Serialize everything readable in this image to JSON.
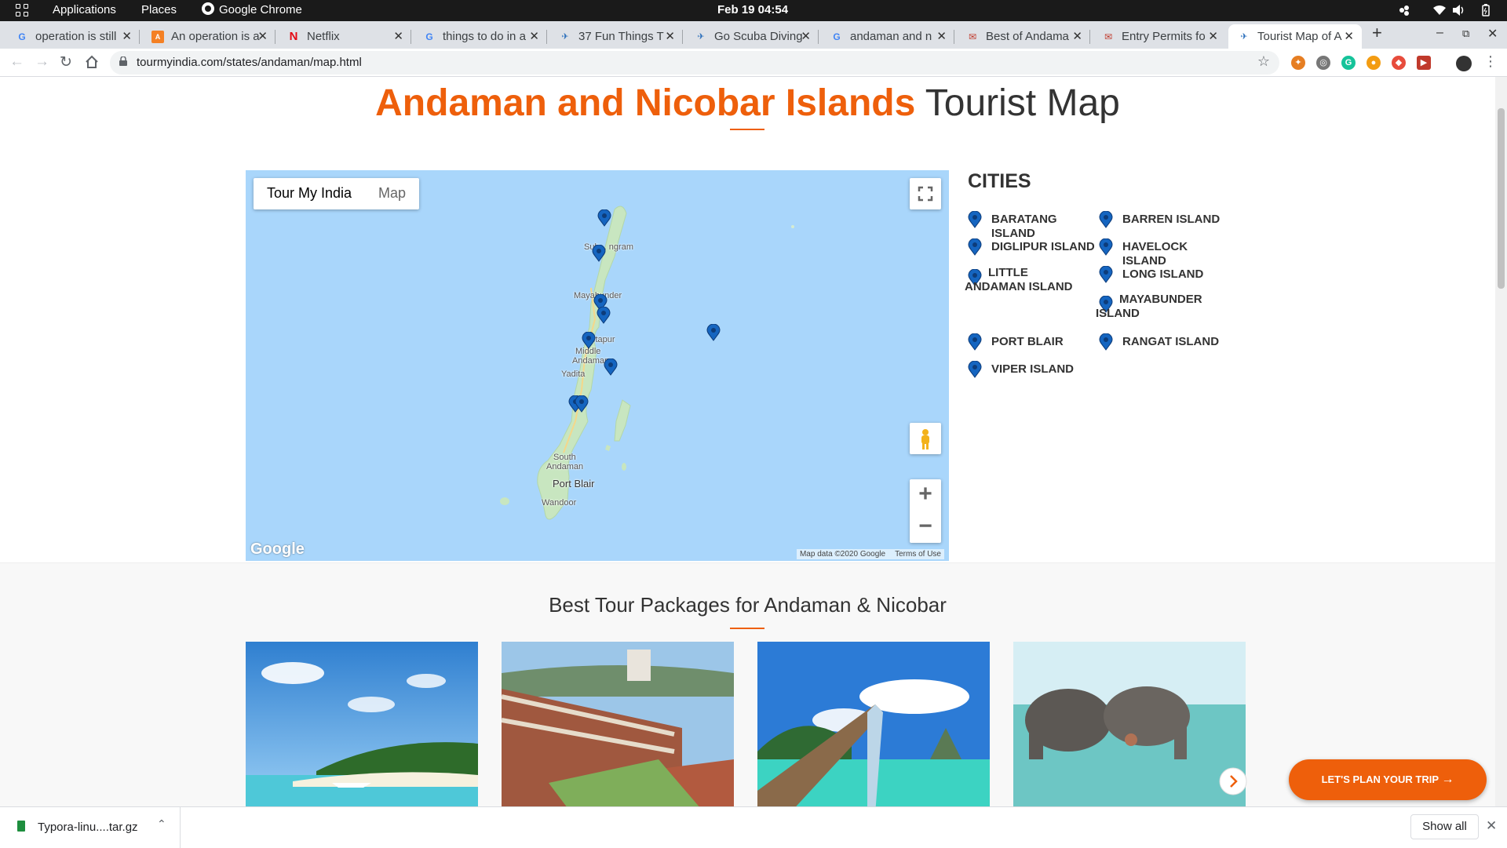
{
  "topbar": {
    "applications": "Applications",
    "places": "Places",
    "active_app": "Google Chrome",
    "clock": "Feb 19  04:54"
  },
  "tabs": [
    {
      "title": "operation is still",
      "icon": "google-icon"
    },
    {
      "title": "An operation is a",
      "icon": "askubuntu-icon"
    },
    {
      "title": "Netflix",
      "icon": "netflix-icon"
    },
    {
      "title": "things to do in a",
      "icon": "google-icon"
    },
    {
      "title": "37 Fun Things T",
      "icon": "site-icon"
    },
    {
      "title": "Go Scuba Diving",
      "icon": "site-icon"
    },
    {
      "title": "andaman and n",
      "icon": "google-icon"
    },
    {
      "title": "Best of Andama",
      "icon": "site-icon"
    },
    {
      "title": "Entry Permits fo",
      "icon": "site-icon"
    },
    {
      "title": "Tourist Map of A",
      "icon": "site-icon"
    }
  ],
  "url": "tourmyindia.com/states/andaman/map.html",
  "page": {
    "title_highlight": "Andaman and Nicobar Islands",
    "title_rest": " Tourist Map"
  },
  "map": {
    "toggle_active": "Tour My India",
    "toggle_inactive": "Map",
    "labels": [
      "Sub... ngram",
      "Mayabunder",
      "Betapur",
      "Middle",
      "Andaman",
      "Yadita",
      "South",
      "Andaman",
      "Port Blair",
      "Wandoor"
    ],
    "google": "Google",
    "attribution": "Map data ©2020 Google",
    "terms": "Terms of Use"
  },
  "cities": {
    "heading": "CITIES",
    "items": [
      "BARATANG ISLAND",
      "BARREN ISLAND",
      "DIGLIPUR ISLAND",
      "HAVELOCK ISLAND",
      "LITTLE ANDAMAN ISLAND",
      "LONG ISLAND",
      "MAYABUNDER ISLAND",
      "PORT BLAIR",
      "RANGAT ISLAND",
      "VIPER ISLAND"
    ],
    "pin_color": "#1565c0"
  },
  "packages": {
    "title": "Best Tour Packages for Andaman & Nicobar"
  },
  "cta": {
    "plan": "LET'S PLAN YOUR TRIP"
  },
  "download": {
    "file": "Typora-linu....tar.gz",
    "show_all": "Show all"
  },
  "colors": {
    "accent": "#ee5f0b",
    "map_water": "#a9d6fb",
    "land": "#c8e6c0"
  }
}
